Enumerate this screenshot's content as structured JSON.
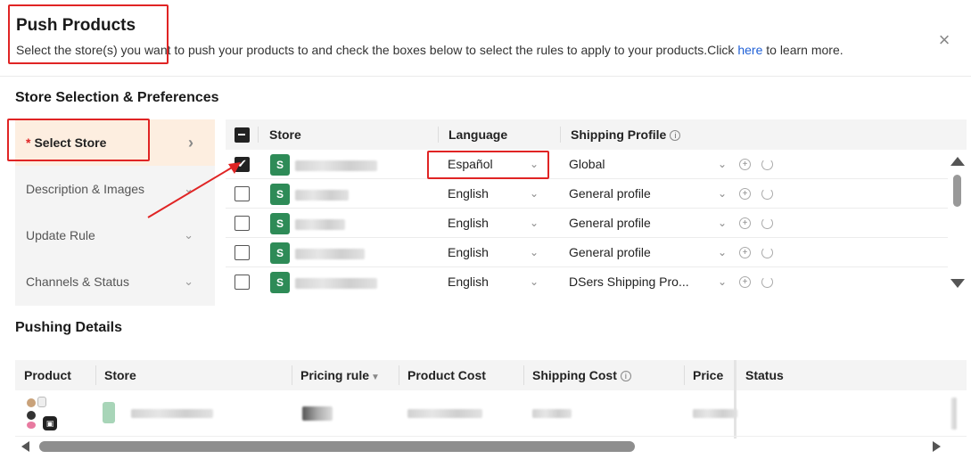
{
  "header": {
    "title": "Push Products",
    "subtitle_prefix": "Select the store(s) you want to push your products to and check the boxes below to select the rules to apply to your products.Click ",
    "subtitle_link": "here",
    "subtitle_suffix": " to learn more.",
    "close_icon": "×"
  },
  "store_section": {
    "title": "Store Selection & Preferences",
    "sidebar": [
      {
        "label": "Select Store",
        "required_mark": "*",
        "chevron": "›"
      },
      {
        "label": "Description & Images",
        "chevron": "⌄"
      },
      {
        "label": "Update Rule",
        "chevron": "⌄"
      },
      {
        "label": "Channels & Status",
        "chevron": "⌄"
      }
    ],
    "columns": {
      "store": "Store",
      "language": "Language",
      "shipping_profile": "Shipping Profile"
    },
    "rows": [
      {
        "checked": true,
        "language": "Español",
        "shipping": "Global"
      },
      {
        "checked": false,
        "language": "English",
        "shipping": "General profile"
      },
      {
        "checked": false,
        "language": "English",
        "shipping": "General profile"
      },
      {
        "checked": false,
        "language": "English",
        "shipping": "General profile"
      },
      {
        "checked": false,
        "language": "English",
        "shipping": "DSers Shipping Pro..."
      }
    ]
  },
  "pushing_details": {
    "title": "Pushing Details",
    "columns": {
      "product": "Product",
      "store": "Store",
      "pricing_rule": "Pricing rule",
      "product_cost": "Product Cost",
      "shipping_cost": "Shipping Cost",
      "price": "Price",
      "status": "Status"
    }
  },
  "colors": {
    "accent_red": "#e02424",
    "link_blue": "#1e5fd6",
    "shop_green": "#2e8b57",
    "active_bg": "#fdeee0"
  }
}
